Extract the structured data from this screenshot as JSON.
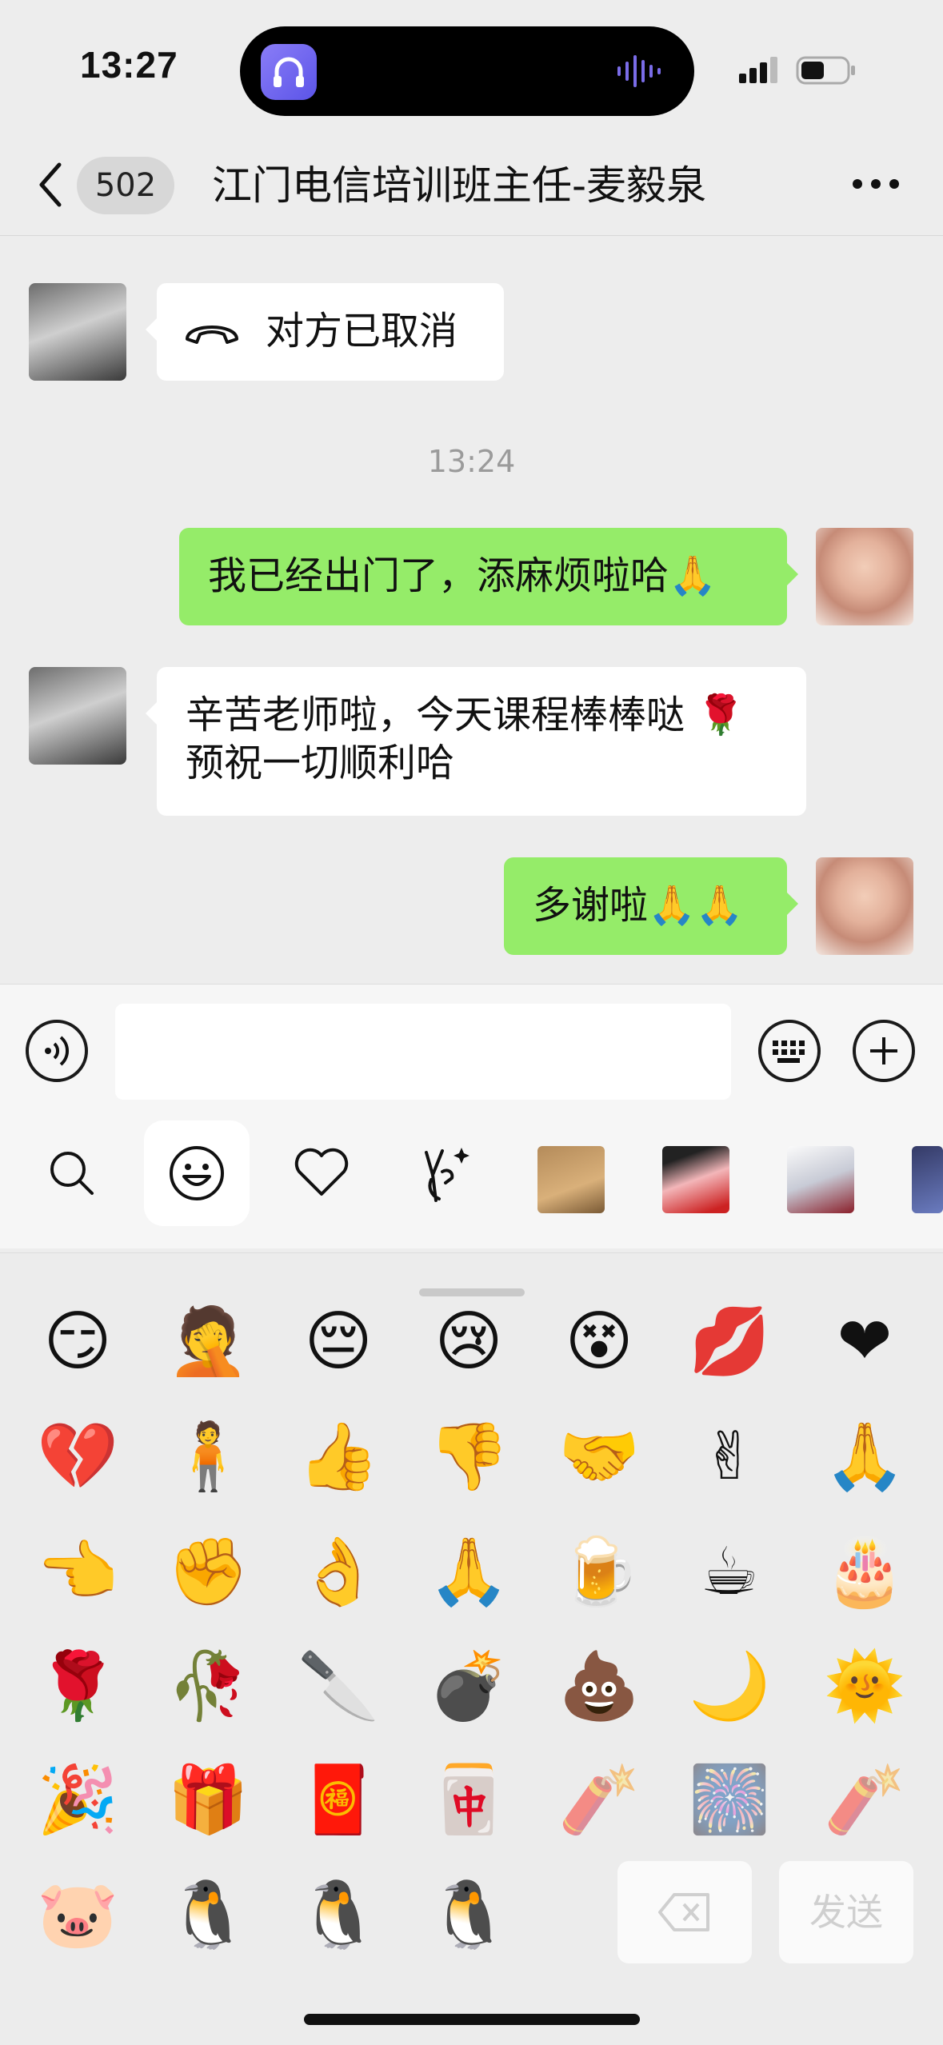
{
  "status_bar": {
    "time": "13:27"
  },
  "header": {
    "unread_count": "502",
    "title": "江门电信培训班主任-麦毅泉"
  },
  "messages": [
    {
      "side": "other",
      "type": "call",
      "text": "对方已取消"
    },
    {
      "side": "me",
      "text": "我已经出门了，添麻烦啦哈",
      "emoji": "🙏"
    },
    {
      "side": "other",
      "text_line1": "辛苦老师啦，今天课程棒棒哒",
      "emoji": "🌹",
      "text_line2": "预祝一切顺利哈"
    },
    {
      "side": "me",
      "text": "多谢啦",
      "emoji": "🙏🙏"
    }
  ],
  "timestamp": "13:24",
  "input": {
    "value": "",
    "placeholder": ""
  },
  "emoji_panel": {
    "rows": [
      [
        "😏",
        "🤦",
        "😔",
        "😢",
        "😵",
        "💋",
        "❤"
      ],
      [
        "💔",
        "🧍",
        "👍",
        "👎",
        "🤝",
        "✌",
        "🙏"
      ],
      [
        "👈",
        "✊",
        "👌",
        "🙏",
        "🍺",
        "☕",
        "🎂"
      ],
      [
        "🌹",
        "🥀",
        "🔪",
        "💣",
        "💩",
        "🌙",
        "🌞"
      ],
      [
        "🎉",
        "🎁",
        "🧧",
        "🀄",
        "🧨",
        "🎆",
        "🧨"
      ],
      [
        "🐷",
        "🐧",
        "🐧",
        "🐧"
      ]
    ],
    "delete_label": "⌫",
    "send_label": "发送"
  }
}
